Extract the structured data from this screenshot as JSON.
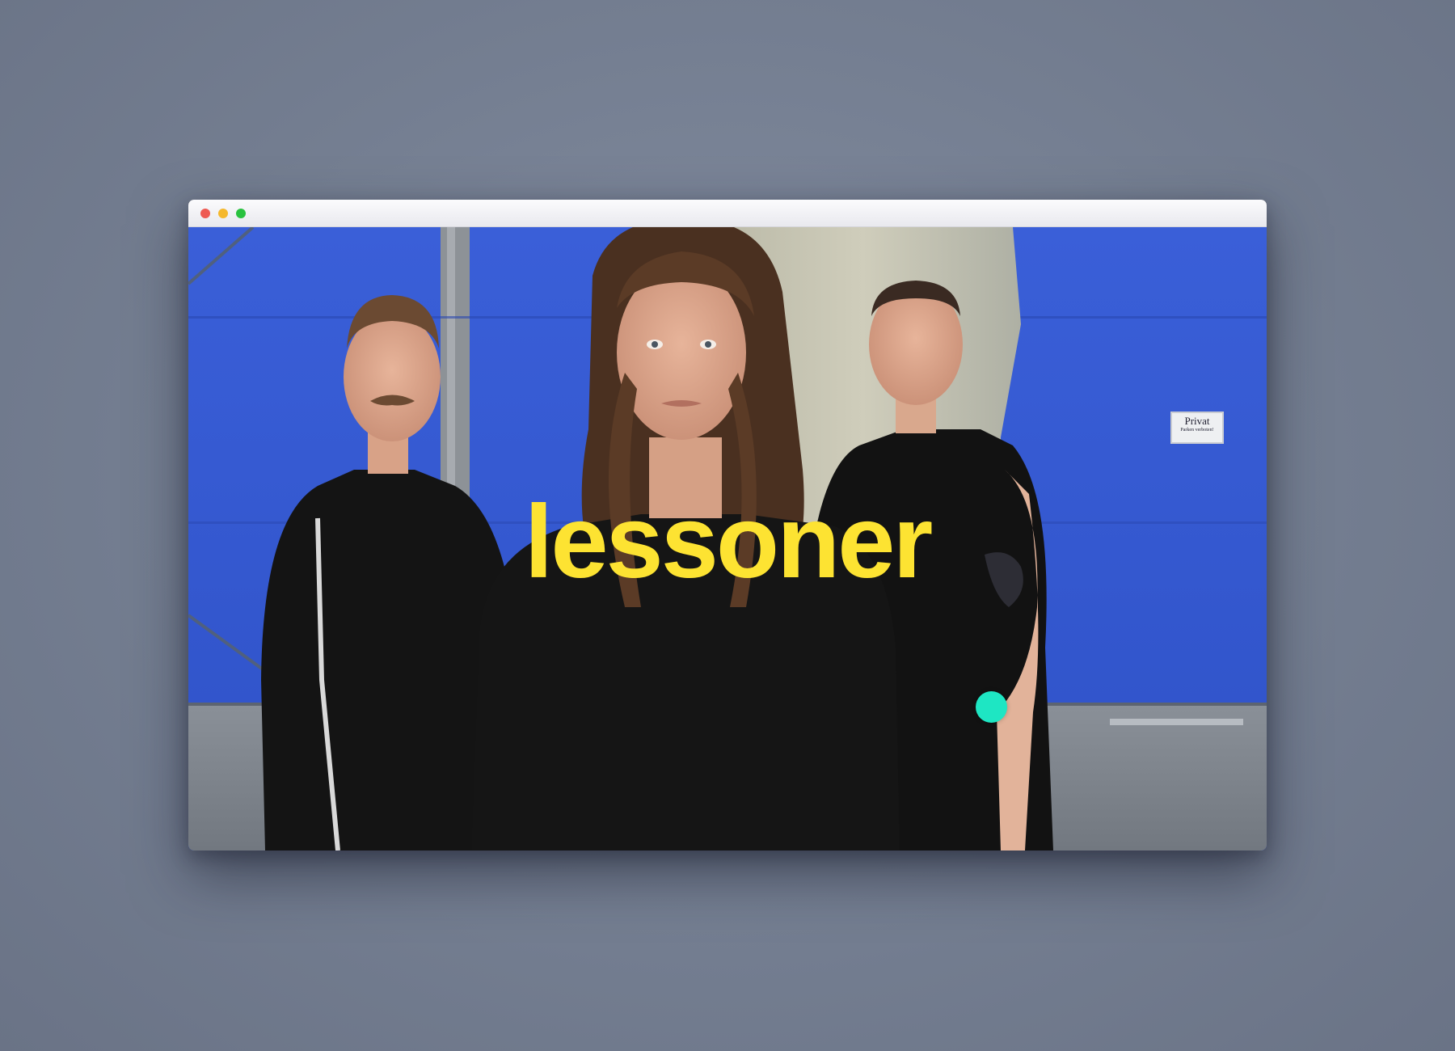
{
  "window": {
    "controls": [
      {
        "name": "close",
        "color": "#ee5a52"
      },
      {
        "name": "minimize",
        "color": "#f5b82c"
      },
      {
        "name": "maximize",
        "color": "#29c23f"
      }
    ]
  },
  "hero": {
    "band_name": "lessoner",
    "band_name_color": "#fde332",
    "cursor_color": "#1ee6c3",
    "wall_sign": {
      "title": "Privat",
      "subtitle": "Parken verboten!"
    }
  }
}
